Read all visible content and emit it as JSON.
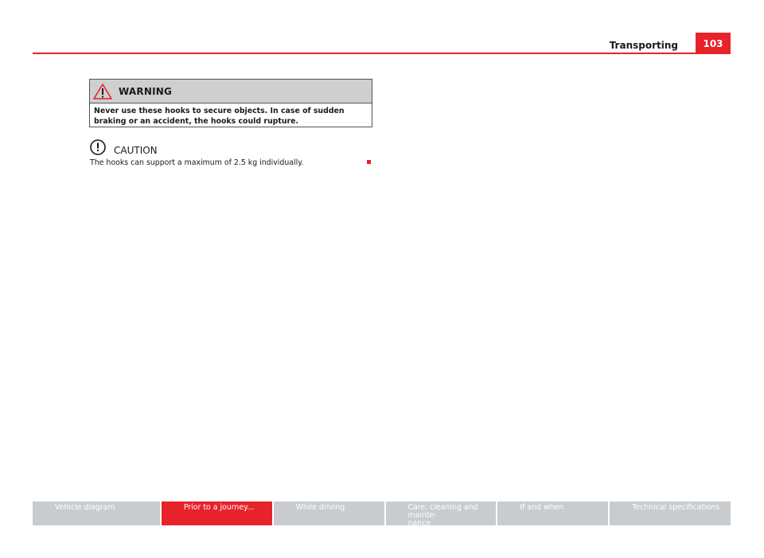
{
  "header": {
    "section_title": "Transporting",
    "page_number": "103",
    "accent_color": "#e8222b"
  },
  "warning": {
    "icon": "warning-triangle-icon",
    "title": "WARNING",
    "text": "Never use these hooks to secure objects. In case of sudden braking or an accident, the hooks could rupture."
  },
  "caution": {
    "icon": "exclamation-circle-icon",
    "title": "CAUTION",
    "text": "The hooks can support a maximum of 2.5 kg individually."
  },
  "footer": {
    "tabs": [
      {
        "label": "Vehicle diagram",
        "active": false
      },
      {
        "label": "Prior to a journey...",
        "active": true
      },
      {
        "label": "While driving",
        "active": false
      },
      {
        "label": "Care, cleaning and mainte-\nnance",
        "active": false
      },
      {
        "label": "If and when",
        "active": false
      },
      {
        "label": "Technical specifications",
        "active": false
      }
    ]
  }
}
